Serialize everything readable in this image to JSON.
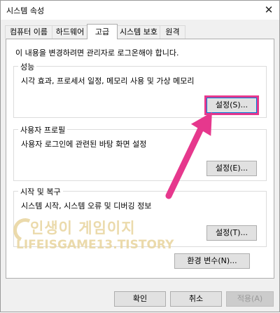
{
  "window": {
    "title": "시스템 속성",
    "close_symbol": "✕"
  },
  "tabs": [
    {
      "label": "컴퓨터 이름"
    },
    {
      "label": "하드웨어"
    },
    {
      "label": "고급"
    },
    {
      "label": "시스템 보호"
    },
    {
      "label": "원격"
    }
  ],
  "panel": {
    "intro": "이 내용을 변경하려면 관리자로 로그온해야 합니다.",
    "performance": {
      "title": "성능",
      "desc": "시각 효과, 프로세서 일정, 메모리 사용 및 가상 메모리",
      "button": "설정(S)..."
    },
    "profile": {
      "title": "사용자 프로필",
      "desc": "사용자 로그인에 관련된 바탕 화면 설정",
      "button": "설정(E)..."
    },
    "startup": {
      "title": "시작 및 복구",
      "desc": "시스템 시작, 시스템 오류 및 디버깅 정보",
      "button": "설정(T)..."
    },
    "env_button": "환경 변수(N)..."
  },
  "footer": {
    "ok": "확인",
    "cancel": "취소",
    "apply": "적용(A)"
  },
  "watermark": {
    "line1": "인생이 게임이지",
    "line2": "LIFEISGAME13.TISTORY"
  },
  "colors": {
    "highlight": "#e6388d",
    "arrow": "#e6388d"
  }
}
